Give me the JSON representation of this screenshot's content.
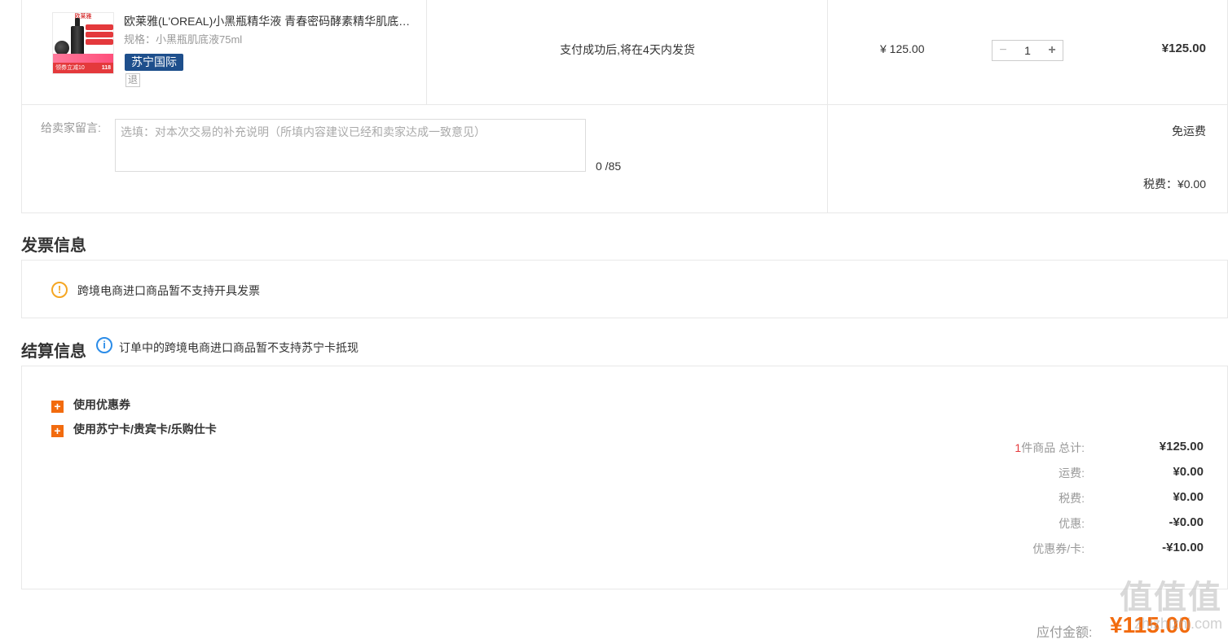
{
  "product": {
    "title": "欧莱雅(L'OREAL)小黑瓶精华液 青春密码酵素精华肌底液面部精华",
    "spec": "规格：小黑瓶肌底液75ml",
    "badge": "苏宁国际",
    "return_icon": "退",
    "shipping_note": "支付成功后,将在4天内发货",
    "unit_price": "¥ 125.00",
    "quantity": "1",
    "line_total": "¥125.00",
    "image_text": {
      "header": "欧莱雅",
      "banner": "领券立减10",
      "price_tag": "118"
    }
  },
  "message": {
    "label": "给卖家留言:",
    "placeholder": "选填：对本次交易的补充说明（所填内容建议已经和卖家达成一致意见）",
    "counter": "0 /85",
    "free_shipping": "免运费",
    "tax": "税费：¥0.00"
  },
  "invoice": {
    "title": "发票信息",
    "note": "跨境电商进口商品暂不支持开具发票"
  },
  "settlement": {
    "title": "结算信息",
    "note": "订单中的跨境电商进口商品暂不支持苏宁卡抵现",
    "options": [
      {
        "label": "使用优惠券"
      },
      {
        "label": "使用苏宁卡/贵宾卡/乐购仕卡"
      }
    ],
    "summary": {
      "count": "1",
      "count_suffix": "件商品 总计:",
      "total": "¥125.00",
      "rows": [
        {
          "label": "运费:",
          "amount": "¥0.00"
        },
        {
          "label": "税费:",
          "amount": "¥0.00"
        },
        {
          "label": "优惠:",
          "amount": "-¥0.00"
        },
        {
          "label": "优惠券/卡:",
          "amount": "-¥10.00"
        }
      ]
    }
  },
  "payable": {
    "label": "应付金额:",
    "amount": "¥115.00"
  },
  "watermark": {
    "logo": "值值值",
    "text": "zhizhizhi.com"
  },
  "colors": {
    "accent_orange": "#f26b0e",
    "badge_blue": "#1e4f8c",
    "warning": "#f5a623",
    "info": "#2b8ce8"
  }
}
